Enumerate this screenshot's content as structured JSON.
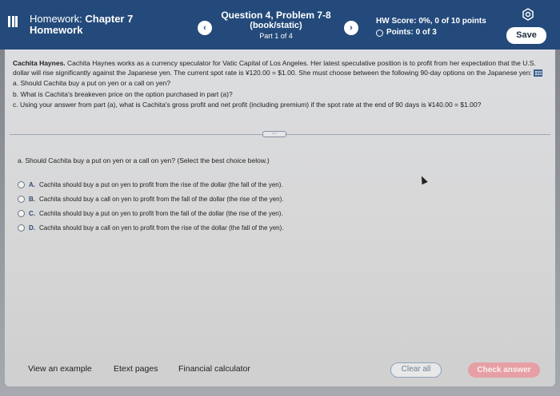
{
  "header": {
    "title_line1": "Homework: ",
    "title_bold": "Chapter 7",
    "title_line2": "Homework",
    "question_title": "Question 4, Problem 7-8",
    "question_sub": "(book/static)",
    "part": "Part 1 of 4",
    "hw_score": "HW Score: 0%, 0 of 10 points",
    "points": "Points: 0 of 3",
    "prev_icon": "chevron-left-icon",
    "next_icon": "chevron-right-icon",
    "settings_icon": "gear-icon",
    "save_label": "Save"
  },
  "problem": {
    "name": "Cachita Haynes.",
    "text": "Cachita Haynes works as a currency speculator for Vatic Capital of Los Angeles. Her latest speculative position is to profit from her expectation that the U.S. dollar will rise significantly against the Japanese yen. The current spot rate is ¥120.00 = $1.00. She must choose between the following 90-day options on the Japanese yen:",
    "part_a": "a. Should Cachita buy a put on yen or a call on yen?",
    "part_b": "b. What is Cachita's breakeven price on the option purchased in part (a)?",
    "part_c": "c. Using your answer from part (a), what is Cachita's gross profit and net profit (including premium) if the spot rate at the end of 90 days is ¥140.00 = $1.00?"
  },
  "question": {
    "prompt": "a. Should Cachita buy a put on yen or a call on yen? (Select the best choice below.)",
    "options": [
      {
        "letter": "A.",
        "text": "Cachita should buy a put on yen to profit from the rise of the dollar (the fall of the yen)."
      },
      {
        "letter": "B.",
        "text": "Cachita should buy a call on yen to profit from the fall of the dollar (the rise of the yen)."
      },
      {
        "letter": "C.",
        "text": "Cachita should buy a put on yen to profit from the fall of the dollar (the rise of the yen)."
      },
      {
        "letter": "D.",
        "text": "Cachita should buy a call on yen to profit from the rise of the dollar (the fall of the yen)."
      }
    ]
  },
  "footer": {
    "view_example": "View an example",
    "etext": "Etext pages",
    "calculator": "Financial calculator",
    "clear_all": "Clear all",
    "check_answer": "Check answer"
  }
}
